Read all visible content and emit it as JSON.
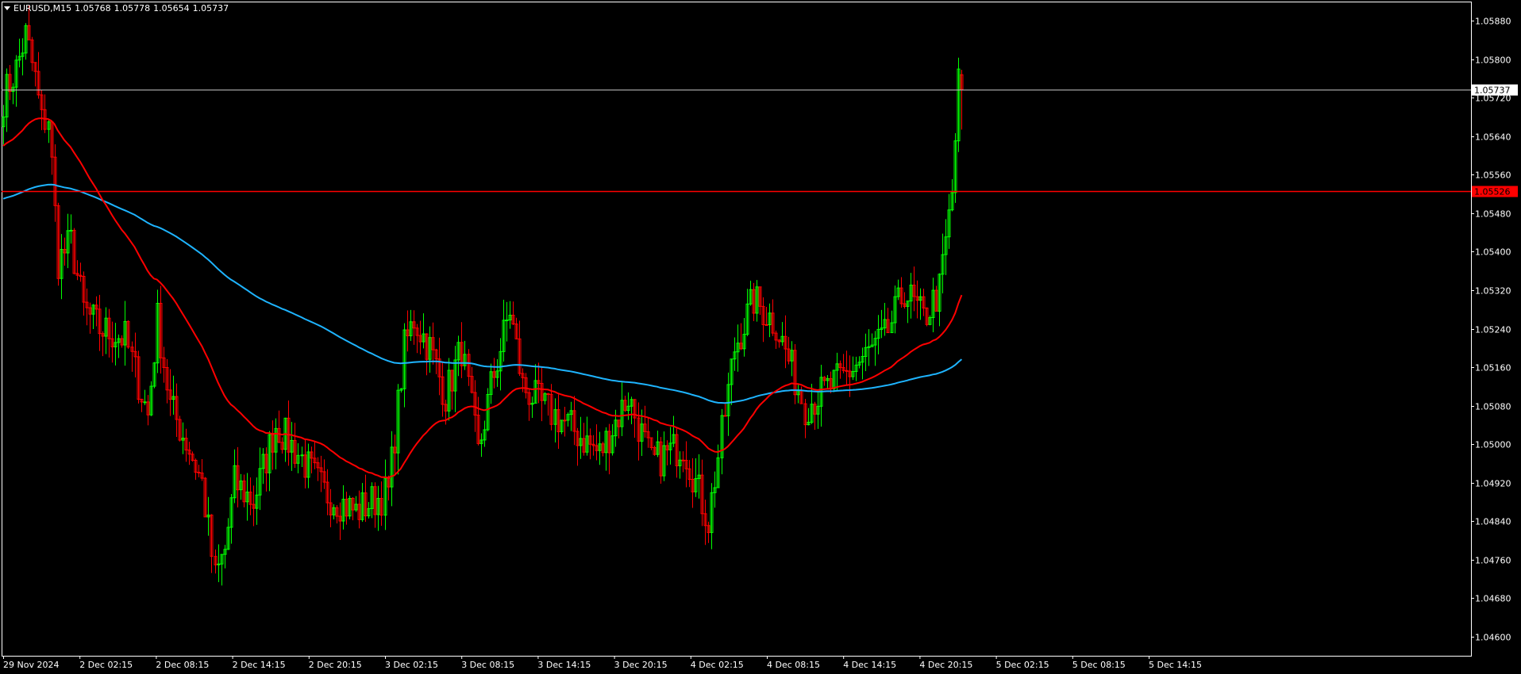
{
  "header": {
    "symbol": "EURUSD,M15",
    "open": "1.05768",
    "high": "1.05778",
    "low": "1.05654",
    "close": "1.05737"
  },
  "colors": {
    "background": "#000000",
    "frame": "#ffffff",
    "bull": "#00ff00",
    "bear": "#ff0000",
    "ma_fast": "#ff0000",
    "ma_slow": "#1eb4ff",
    "bid_line": "#c0c0c0",
    "level_line": "#ff0000"
  },
  "chart_data": {
    "type": "candlestick",
    "symbol": "EURUSD",
    "timeframe": "M15",
    "ylim": [
      1.0456,
      1.0592
    ],
    "y_ticks": [
      "1.05880",
      "1.05800",
      "1.05720",
      "1.05640",
      "1.05560",
      "1.05480",
      "1.05400",
      "1.05320",
      "1.05240",
      "1.05160",
      "1.05080",
      "1.05000",
      "1.04920",
      "1.04840",
      "1.04760",
      "1.04680",
      "1.04600"
    ],
    "x_ticks": [
      "29 Nov 2024",
      "2 Dec 02:15",
      "2 Dec 08:15",
      "2 Dec 14:15",
      "2 Dec 20:15",
      "3 Dec 02:15",
      "3 Dec 08:15",
      "3 Dec 14:15",
      "3 Dec 20:15",
      "4 Dec 02:15",
      "4 Dec 08:15",
      "4 Dec 14:15",
      "4 Dec 20:15",
      "5 Dec 02:15",
      "5 Dec 08:15",
      "5 Dec 14:15"
    ],
    "current_price": "1.05737",
    "level_price": "1.05526",
    "candle_count": 300,
    "anchors": [
      [
        0,
        1.0572
      ],
      [
        4,
        1.0578
      ],
      [
        7,
        1.0585
      ],
      [
        10,
        1.0576
      ],
      [
        12,
        1.0567
      ],
      [
        14,
        1.0568
      ],
      [
        17,
        1.0538
      ],
      [
        21,
        1.0542
      ],
      [
        25,
        1.0528
      ],
      [
        30,
        1.0524
      ],
      [
        38,
        1.0522
      ],
      [
        45,
        1.0506
      ],
      [
        48,
        1.0526
      ],
      [
        52,
        1.0508
      ],
      [
        58,
        1.0499
      ],
      [
        62,
        1.0492
      ],
      [
        66,
        1.0472
      ],
      [
        69,
        1.0478
      ],
      [
        72,
        1.0492
      ],
      [
        78,
        1.0488
      ],
      [
        85,
        1.0504
      ],
      [
        92,
        1.0498
      ],
      [
        100,
        1.049
      ],
      [
        110,
        1.0486
      ],
      [
        120,
        1.049
      ],
      [
        125,
        1.052
      ],
      [
        128,
        1.0526
      ],
      [
        133,
        1.052
      ],
      [
        138,
        1.051
      ],
      [
        143,
        1.052
      ],
      [
        148,
        1.0498
      ],
      [
        152,
        1.0512
      ],
      [
        158,
        1.0528
      ],
      [
        162,
        1.0512
      ],
      [
        168,
        1.0508
      ],
      [
        176,
        1.0504
      ],
      [
        186,
        1.0498
      ],
      [
        195,
        1.051
      ],
      [
        202,
        1.0496
      ],
      [
        212,
        1.05
      ],
      [
        220,
        1.0484
      ],
      [
        228,
        1.052
      ],
      [
        234,
        1.053
      ],
      [
        241,
        1.0525
      ],
      [
        250,
        1.0508
      ],
      [
        262,
        1.0514
      ],
      [
        275,
        1.0522
      ],
      [
        281,
        1.0532
      ],
      [
        287,
        1.0526
      ],
      [
        292,
        1.0532
      ],
      [
        296,
        1.0552
      ],
      [
        298,
        1.0575
      ],
      [
        299,
        1.05737
      ]
    ]
  }
}
